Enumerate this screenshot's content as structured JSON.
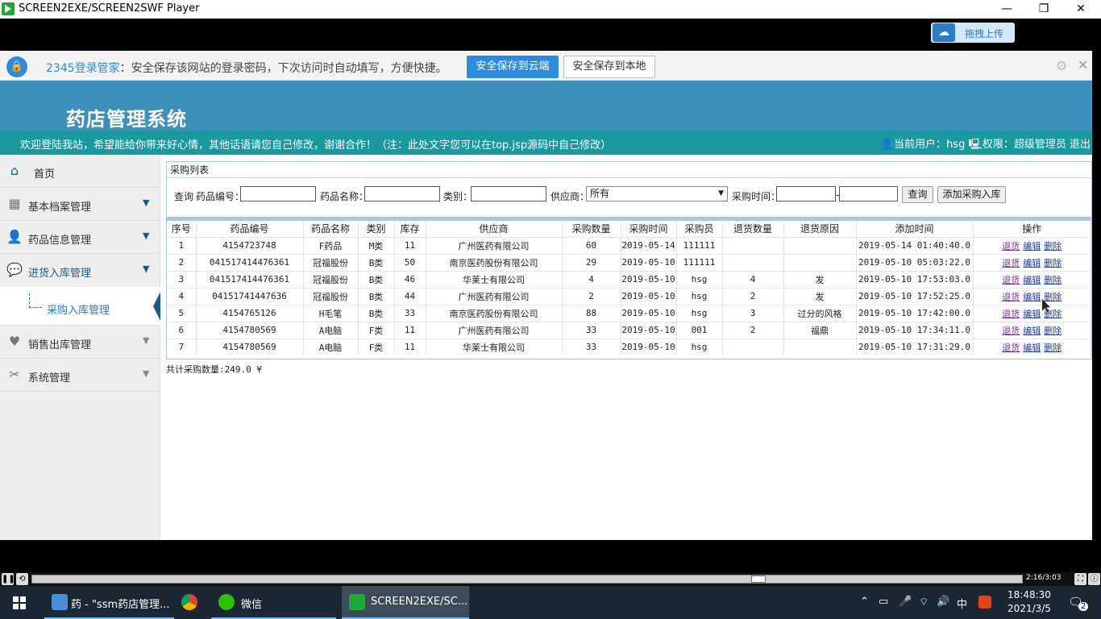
{
  "window": {
    "title": "SCREEN2EXE/SCREEN2SWF Player",
    "min": "—",
    "max": "❐",
    "close": "✕"
  },
  "upload": {
    "label": "拖拽上传"
  },
  "pwbar": {
    "brand": "2345登录管家",
    "message": "：安全保存该网站的登录密码，下次访问时自动填写，方便快捷。",
    "cloud_btn": "安全保存到云端",
    "local_btn": "安全保存到本地"
  },
  "header": {
    "title": "药店管理系统"
  },
  "welcome": {
    "text": "欢迎登陆我站，希望能给你带来好心情，其他话语请您自己修改，谢谢合作！（注：此处文字您可以在top.jsp源码中自己修改）",
    "user_label": "当前用户：",
    "user_name": "hsg",
    "role_label": "权限：",
    "role": "超级管理员",
    "logout": "退出"
  },
  "sidebar": {
    "items": [
      {
        "label": "首页",
        "icon": "home-icon"
      },
      {
        "label": "基本档案管理",
        "icon": "grid-icon"
      },
      {
        "label": "药品信息管理",
        "icon": "user-icon"
      },
      {
        "label": "进货入库管理",
        "icon": "chat-icon"
      },
      {
        "label": "销售出库管理",
        "icon": "heart-icon"
      },
      {
        "label": "系统管理",
        "icon": "tools-icon"
      }
    ],
    "sub_item": "采购入库管理"
  },
  "panel": {
    "title": "采购列表",
    "query_label": "查询",
    "code_label": "药品编号：",
    "name_label": "药品名称：",
    "category_label": "类别：",
    "supplier_label": "供应商：",
    "supplier_value": "所有",
    "time_label": "采购时间：",
    "time_sep": "-",
    "query_btn": "查询",
    "add_btn": "添加采购入库"
  },
  "table": {
    "headers": [
      "序号",
      "药品编号",
      "药品名称",
      "类别",
      "库存",
      "供应商",
      "采购数量",
      "采购时间",
      "采购员",
      "退货数量",
      "退货原因",
      "添加时间",
      "操作"
    ],
    "rows": [
      [
        "1",
        "4154723748",
        "F药品",
        "M类",
        "11",
        "广州医药有限公司",
        "60",
        "2019-05-14",
        "111111",
        "",
        "",
        "2019-05-14 01:40:40.0"
      ],
      [
        "2",
        "041517414476361",
        "冠福股份",
        "B类",
        "50",
        "南京医药股份有限公司",
        "29",
        "2019-05-10",
        "111111",
        "",
        "",
        "2019-05-10 05:03:22.0"
      ],
      [
        "3",
        "041517414476361",
        "冠福股份",
        "B类",
        "46",
        "华莱士有限公司",
        "4",
        "2019-05-10",
        "hsg",
        "4",
        "发",
        "2019-05-10 17:53:03.0"
      ],
      [
        "4",
        "04151741447636",
        "冠福股份",
        "B类",
        "44",
        "广州医药有限公司",
        "2",
        "2019-05-10",
        "hsg",
        "2",
        "发",
        "2019-05-10 17:52:25.0"
      ],
      [
        "5",
        "4154765126",
        "H毛笔",
        "B类",
        "33",
        "南京医药股份有限公司",
        "88",
        "2019-05-10",
        "hsg",
        "3",
        "过分的风格",
        "2019-05-10 17:42:00.0"
      ],
      [
        "6",
        "4154780569",
        "A电脑",
        "F类",
        "11",
        "广州医药有限公司",
        "33",
        "2019-05-10",
        "001",
        "2",
        "福鼎",
        "2019-05-10 17:34:11.0"
      ],
      [
        "7",
        "4154780569",
        "A电脑",
        "F类",
        "11",
        "华莱士有限公司",
        "33",
        "2019-05-10",
        "hsg",
        "",
        "",
        "2019-05-10 17:31:29.0"
      ]
    ],
    "ops": [
      "退货",
      "编辑",
      "删除"
    ]
  },
  "total": "共计采购数量:249.0 ¥",
  "player": {
    "time": "2:16/3:03",
    "progress": 0.737
  },
  "taskbar": {
    "tasks": [
      "药 - \"ssm药店管理...",
      "微信",
      "SCREEN2EXE/SC..."
    ],
    "tray_ime": "中",
    "time": "18:48:30",
    "date": "2021/3/5",
    "notif": "2"
  }
}
